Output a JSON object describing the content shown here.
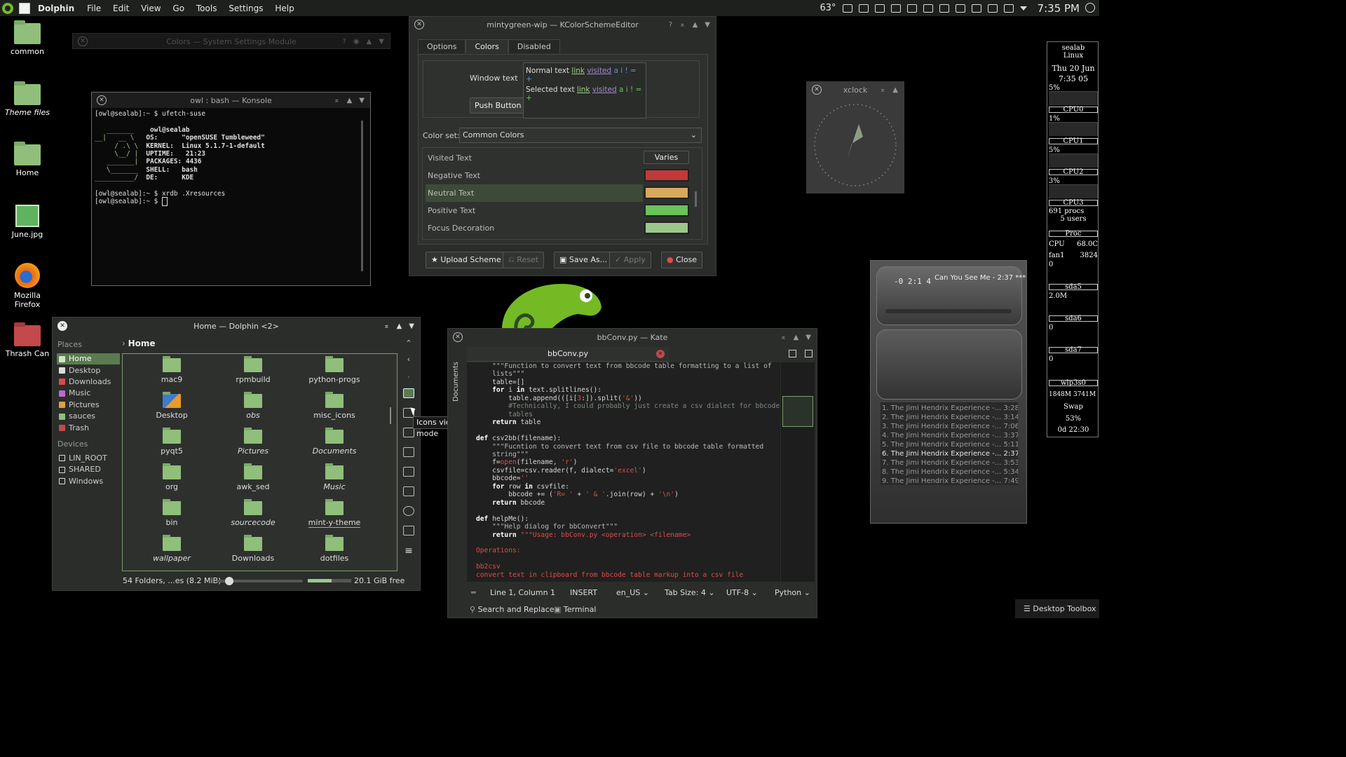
{
  "panel": {
    "app_name": "Dolphin",
    "menu": [
      "File",
      "Edit",
      "View",
      "Go",
      "Tools",
      "Settings",
      "Help"
    ],
    "temperature": "63°",
    "time": "7:35 PM"
  },
  "desktop_icons": [
    {
      "label": "common"
    },
    {
      "label": "Theme files"
    },
    {
      "label": "Home"
    },
    {
      "label": "June.jpg"
    },
    {
      "label": "Mozilla Firefox"
    },
    {
      "label": "Thrash Can"
    }
  ],
  "colors_window": {
    "title": "Colors — System Settings Module"
  },
  "konsole": {
    "title": "owl : bash — Konsole",
    "prompt": "[owl@sealab]:~ $",
    "cmd1": "ufetch-suse",
    "userhost": "owl@sealab",
    "fetch": [
      {
        "key": "OS:",
        "value": "\"openSUSE Tumbleweed\""
      },
      {
        "key": "KERNEL:",
        "value": "Linux 5.1.7-1-default"
      },
      {
        "key": "UPTIME:",
        "value": " 21:23"
      },
      {
        "key": "PACKAGES:",
        "value": "4436"
      },
      {
        "key": "SHELL:",
        "value": "bash"
      },
      {
        "key": "DE:",
        "value": "KDE"
      }
    ],
    "cmd2": "xrdb .Xresources"
  },
  "kcse": {
    "title": "mintygreen-wip — KColorSchemeEditor",
    "tabs": [
      "Options",
      "Colors",
      "Disabled"
    ],
    "window_text": "Window text",
    "push_button": "Push Button",
    "normal_text": "Normal text",
    "selected_text": "Selected text",
    "link": "link",
    "visited": "visited",
    "tail": "a i ! = +",
    "color_set_label": "Color set:",
    "color_set_value": "Common Colors",
    "rows": [
      {
        "name": "Visited Text",
        "value": "Varies"
      },
      {
        "name": "Negative Text",
        "color": "#c03a3a"
      },
      {
        "name": "Neutral Text",
        "color": "#d6a95c"
      },
      {
        "name": "Positive Text",
        "color": "#6ac25a"
      },
      {
        "name": "Focus Decoration",
        "color": "#9cc78a"
      }
    ],
    "buttons": {
      "upload": "Upload Scheme",
      "reset": "Reset",
      "save": "Save As...",
      "apply": "Apply",
      "close": "Close"
    }
  },
  "xclock": {
    "title": "xclock"
  },
  "conky": {
    "host": "sealab",
    "os": "Linux",
    "date": "Thu 20 Jun",
    "time": "7:35 05",
    "cpus": [
      {
        "label": "CPU0",
        "pct": "5%"
      },
      {
        "label": "CPU1",
        "pct": "1%"
      },
      {
        "label": "CPU2",
        "pct": "5%"
      },
      {
        "label": "CPU3",
        "pct": "3%"
      }
    ],
    "procs": "691 procs",
    "users": "5 users",
    "proc_label": "Proc",
    "cpu_temp_label": "CPU",
    "cpu_temp": "68.0C",
    "fan_label": "fan1",
    "fan": "3824",
    "sda5_label": "sda5",
    "sda5_val": "2.0M",
    "sda6_label": "sda6",
    "sda6_val": "0",
    "sda7_label": "sda7",
    "sda7_val": "0",
    "zero_a": "0",
    "wlp": "wlp3s0",
    "mem": "1848M 3741M",
    "swap": "Swap",
    "swap_pct": "53%",
    "uptime": "0d 22:30"
  },
  "player": {
    "time": "-0 2:1 4",
    "track": "Can You See Me - 2:37 ***",
    "playlist": [
      {
        "title": "1. The Jimi Hendrix Experience -...",
        "len": "3:28"
      },
      {
        "title": "2. The Jimi Hendrix Experience -...",
        "len": "3:14"
      },
      {
        "title": "3. The Jimi Hendrix Experience -...",
        "len": "7:06"
      },
      {
        "title": "4. The Jimi Hendrix Experience -...",
        "len": "3:37"
      },
      {
        "title": "5. The Jimi Hendrix Experience -...",
        "len": "5:11"
      },
      {
        "title": "6. The Jimi Hendrix Experience -...",
        "len": "2:37"
      },
      {
        "title": "7. The Jimi Hendrix Experience -...",
        "len": "3:53"
      },
      {
        "title": "8. The Jimi Hendrix Experience -...",
        "len": "5:34"
      },
      {
        "title": "9. The Jimi Hendrix Experience -...",
        "len": "7:49"
      }
    ]
  },
  "dolphin": {
    "title": "Home — Dolphin <2>",
    "breadcrumb": "Home",
    "places_label": "Places",
    "places": [
      "Home",
      "Desktop",
      "Downloads",
      "Music",
      "Pictures",
      "sauces",
      "Trash"
    ],
    "devices_label": "Devices",
    "devices": [
      "LIN_ROOT",
      "SHARED",
      "Windows"
    ],
    "files": [
      "mac9",
      "rpmbuild",
      "python-progs",
      "Desktop",
      "obs",
      "misc_icons",
      "pyqt5",
      "Pictures",
      "Documents",
      "org",
      "awk_sed",
      "Music",
      "bin",
      "sourcecode",
      "mint-y-theme",
      "wallpaper",
      "Downloads",
      "dotfiles"
    ],
    "status": "54 Folders, ...es (8.2 MiB)",
    "free": "20.1 GiB free",
    "zoom": 0.1
  },
  "tooltip": "Icons view mode",
  "kate": {
    "title": "bbConv.py — Kate",
    "tab": "bbConv.py",
    "side": "Documents",
    "status": {
      "pos": "Line 1, Column 1",
      "mode": "INSERT",
      "lang": "en_US",
      "tab": "Tab Size: 4",
      "enc": "UTF-8",
      "syntax": "Python"
    },
    "search": "Search and Replace",
    "terminal": "Terminal"
  },
  "toolbox": "Desktop Toolbox"
}
